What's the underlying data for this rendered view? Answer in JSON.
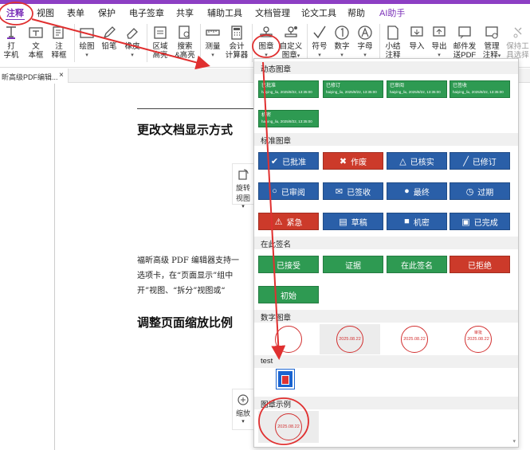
{
  "colors": {
    "accent": "#7a2fb8",
    "annotation_red": "#e03030"
  },
  "menubar": {
    "items": [
      {
        "label": "注释",
        "active": true
      },
      {
        "label": "视图"
      },
      {
        "label": "表单"
      },
      {
        "label": "保护"
      },
      {
        "label": "电子签章"
      },
      {
        "label": "共享"
      },
      {
        "label": "辅助工具"
      },
      {
        "label": "文档管理"
      },
      {
        "label": "论文工具"
      },
      {
        "label": "帮助"
      },
      {
        "label": "AI助手"
      }
    ]
  },
  "ribbon": {
    "typewriter": {
      "line1": "打",
      "line2": "字机",
      "icon": "typewriter-icon"
    },
    "textbox": {
      "line1": "文",
      "line2": "本框",
      "icon": "textbox-icon"
    },
    "note": {
      "line1": "注",
      "line2": "释框",
      "icon": "note-icon"
    },
    "draw": {
      "label": "绘图",
      "icon": "rectangle-icon"
    },
    "pencil": {
      "label": "铅笔",
      "icon": "pencil-icon"
    },
    "eraser": {
      "label": "橡皮",
      "icon": "eraser-icon"
    },
    "area_highlight": {
      "line1": "区域",
      "line2": "高亮",
      "icon": "area-highlight-icon"
    },
    "search_highlight": {
      "line1": "搜索",
      "line2": "&高亮",
      "icon": "search-highlight-icon"
    },
    "measure": {
      "label": "测量",
      "icon": "ruler-icon"
    },
    "calc": {
      "line1": "会计",
      "line2": "计算器",
      "icon": "calculator-icon"
    },
    "stamp": {
      "label": "图章",
      "icon": "stamp-icon"
    },
    "custom_stamp": {
      "line1": "自定义",
      "line2": "图章",
      "icon": "custom-stamp-icon"
    },
    "symbol": {
      "label": "符号",
      "icon": "checkmark-icon"
    },
    "number": {
      "label": "数字",
      "icon": "circled-one-icon"
    },
    "letter": {
      "label": "字母",
      "icon": "circled-a-icon"
    },
    "summary": {
      "line1": "小结",
      "line2": "注释",
      "icon": "summary-icon"
    },
    "import": {
      "label": "导入",
      "icon": "import-icon"
    },
    "export": {
      "label": "导出",
      "icon": "export-icon"
    },
    "email": {
      "line1": "邮件发",
      "line2": "送PDF",
      "icon": "email-icon"
    },
    "manage": {
      "line1": "管理",
      "line2": "注释",
      "icon": "manage-icon"
    },
    "keep_tool": {
      "line1": "保持工",
      "line2": "具选择",
      "icon": "keep-tool-icon"
    }
  },
  "tab": {
    "label": "昕高级PDF编辑...",
    "close": "×"
  },
  "document": {
    "heading1": "更改文档显示方式",
    "para1": "福昕高级 PDF 编辑器支持一",
    "para2": "选项卡，在“页面显示”组中",
    "para3": "开”视图、“拆分”视图或“",
    "heading2": "调整页面缩放比例",
    "rotate_label1": "旋转",
    "rotate_label2": "视图",
    "zoom_label": "缩放"
  },
  "stamp_menu": {
    "dynamic_header": "动态图章",
    "dynamic": [
      {
        "title": "已批准",
        "sub": "haiying_liu, 2025/8/22, 13:35:00"
      },
      {
        "title": "已修订",
        "sub": "haiying_liu, 2025/8/22, 13:35:00"
      },
      {
        "title": "已审阅",
        "sub": "haiying_liu, 2025/8/22, 13:35:00"
      },
      {
        "title": "已签收",
        "sub": "haiying_liu, 2025/8/22, 13:35:00"
      },
      {
        "title": "机密",
        "sub": "haiying_liu, 2025/8/22, 13:35:00"
      }
    ],
    "standard_header": "标准图章",
    "standard": [
      {
        "label": "已批准",
        "icon": "✔",
        "color": "blue",
        "icon_name": "check-icon"
      },
      {
        "label": "作废",
        "icon": "✖",
        "color": "red",
        "icon_name": "cross-icon"
      },
      {
        "label": "已核实",
        "icon": "△",
        "color": "blue",
        "icon_name": "warning-outline-icon"
      },
      {
        "label": "已修订",
        "icon": "╱",
        "color": "blue",
        "icon_name": "pen-icon"
      },
      {
        "label": "已审阅",
        "icon": "○",
        "color": "blue",
        "icon_name": "magnifier-icon"
      },
      {
        "label": "已签收",
        "icon": "✉",
        "color": "blue",
        "icon_name": "mail-icon"
      },
      {
        "label": "最终",
        "icon": "●",
        "color": "blue",
        "icon_name": "person-icon"
      },
      {
        "label": "过期",
        "icon": "◷",
        "color": "blue",
        "icon_name": "clock-icon"
      },
      {
        "label": "紧急",
        "icon": "⚠",
        "color": "red",
        "icon_name": "alert-icon"
      },
      {
        "label": "草稿",
        "icon": "▤",
        "color": "blue",
        "icon_name": "draft-icon"
      },
      {
        "label": "机密",
        "icon": "■",
        "color": "blue",
        "icon_name": "lock-icon"
      },
      {
        "label": "已完成",
        "icon": "▣",
        "color": "blue",
        "icon_name": "done-icon"
      }
    ],
    "sign_header": "在此签名",
    "sign": [
      {
        "label": "已接受",
        "color": "green"
      },
      {
        "label": "证据",
        "color": "green"
      },
      {
        "label": "在此签名",
        "color": "green"
      },
      {
        "label": "已拒绝",
        "color": "red"
      },
      {
        "label": "初始",
        "color": "green"
      }
    ],
    "digital_header": "数字图章",
    "digital": [
      {
        "text": "",
        "top": ""
      },
      {
        "text": "2025.08.22",
        "top": ""
      },
      {
        "text": "2025.08.22",
        "top": ""
      },
      {
        "text": "2025.08.22",
        "top": "审批"
      }
    ],
    "test_header": "test",
    "example_header": "图章示例",
    "example": [
      {
        "text": "2025.08.22"
      }
    ]
  }
}
